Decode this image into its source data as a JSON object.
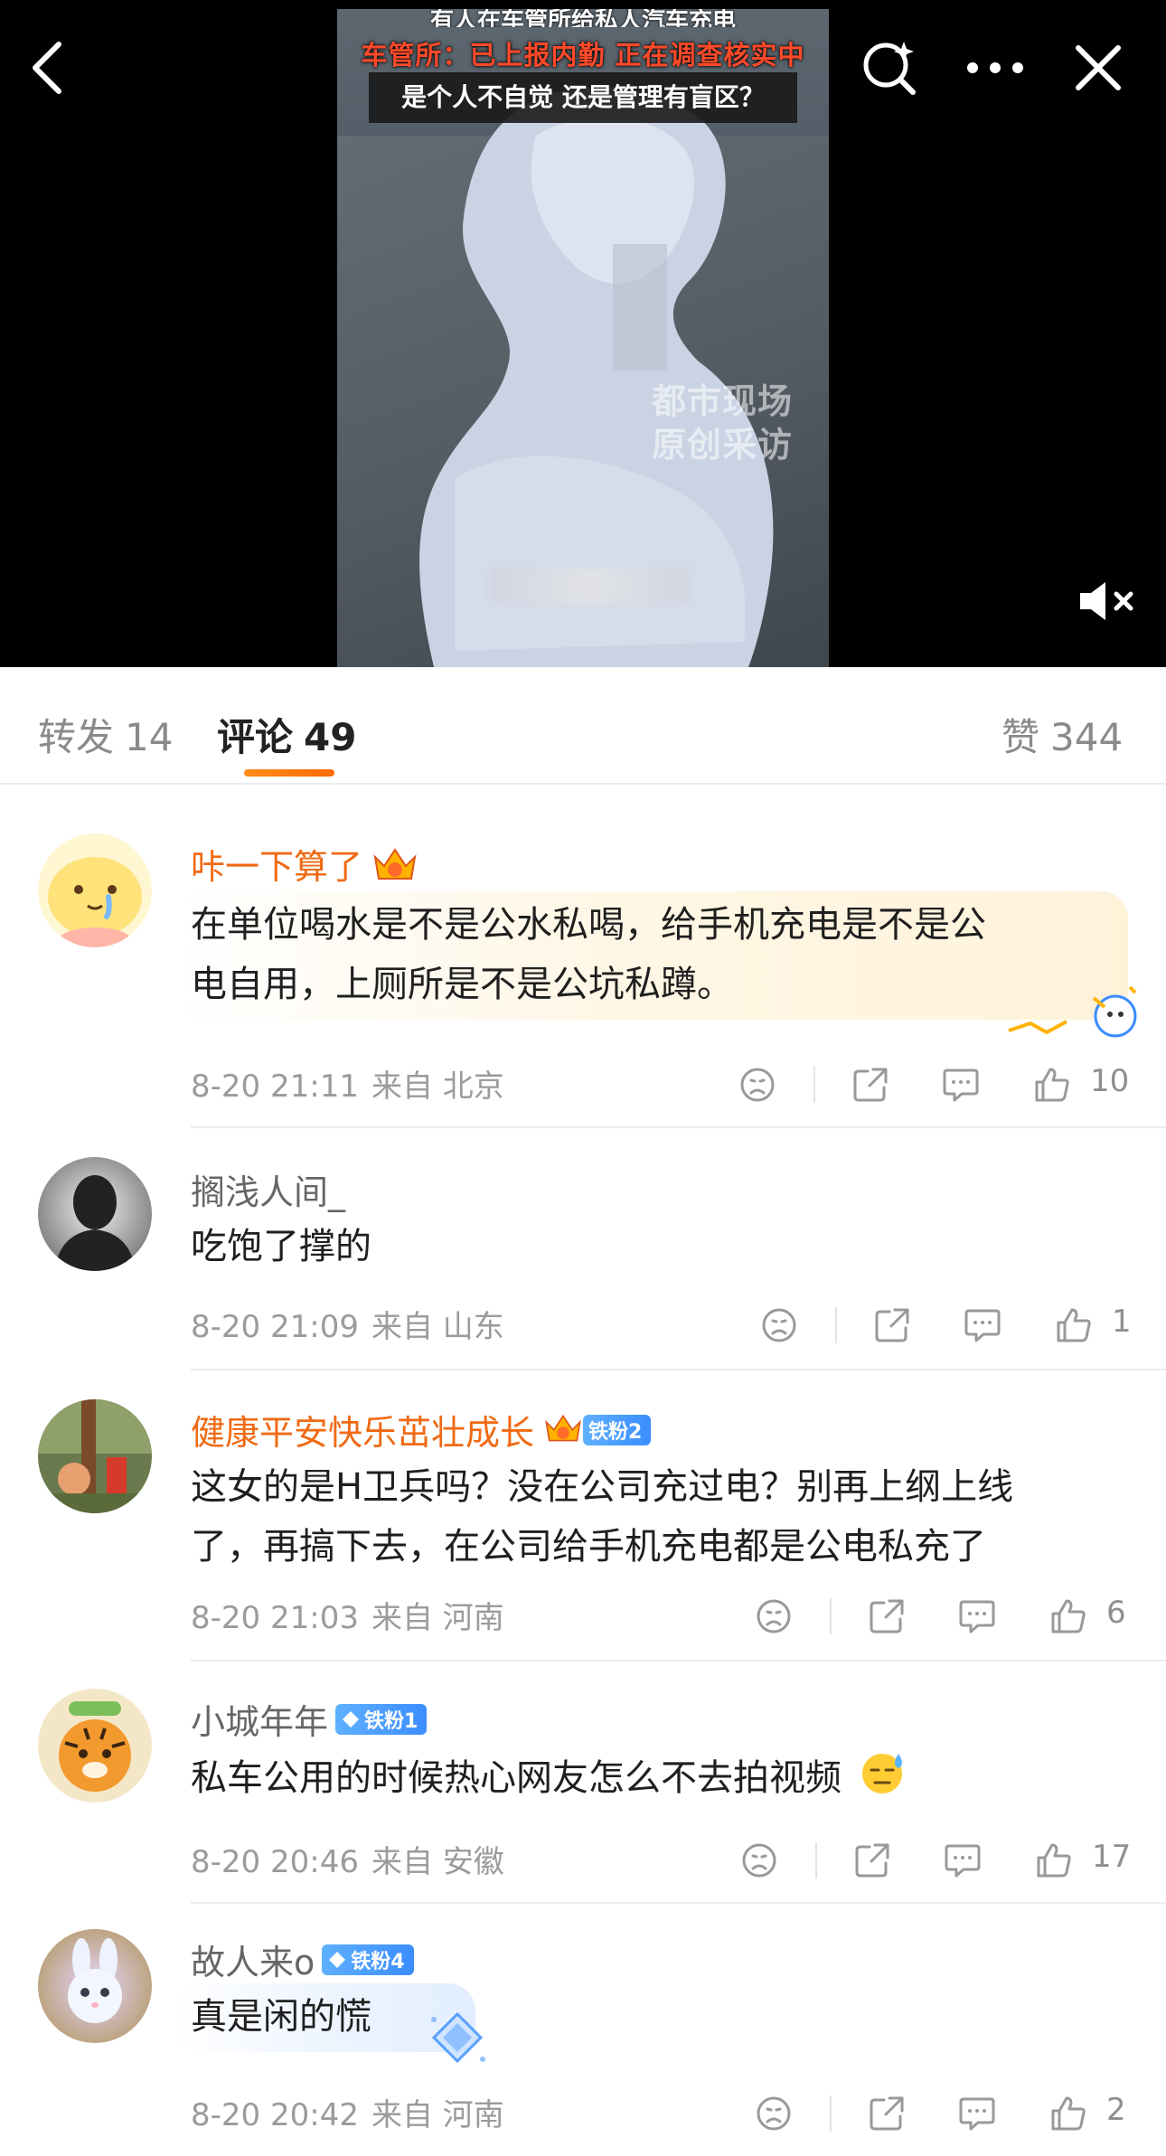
{
  "video": {
    "caption_top": "有人在车管所给私人汽车充电",
    "caption_mid": "车管所：已上报内勤 正在调查核实中",
    "caption_bottom": "是个人不自觉 还是管理有盲区？",
    "watermark_line1": "都市现场",
    "watermark_line2": "原创采访",
    "icons": [
      "back-icon",
      "ai-search-icon",
      "more-icon",
      "close-icon",
      "mute-icon"
    ]
  },
  "tabs": {
    "repost_label": "转发",
    "repost_count": "14",
    "comment_label": "评论",
    "comment_count": "49",
    "like_label": "赞",
    "like_count": "344",
    "accent": "#ff7a00"
  },
  "comments": [
    {
      "username": "咔一下算了",
      "username_color": "#f06a14",
      "text_line1": "在单位喝水是不是公水私喝，给手机充电是不是公",
      "text_line2": "电自用，上厕所是不是公坑私蹲。",
      "time": "8-20 21:11",
      "from": "来自 北京",
      "likes": "10"
    },
    {
      "username": "搁浅人间_",
      "text_line1": "吃饱了撑的",
      "time": "8-20 21:09",
      "from": "来自 山东",
      "likes": "1"
    },
    {
      "username": "健康平安快乐茁壮成长",
      "username_color": "#f06a14",
      "badge": "铁粉2",
      "text_line1": "这女的是H卫兵吗？没在公司充过电？别再上纲上线",
      "text_line2": "了，再搞下去，在公司给手机充电都是公电私充了",
      "time": "8-20 21:03",
      "from": "来自 河南",
      "likes": "6"
    },
    {
      "username": "小城年年",
      "badge": "铁粉1",
      "text_line1": "私车公用的时候热心网友怎么不去拍视频",
      "time": "8-20 20:46",
      "from": "来自 安徽",
      "likes": "17"
    },
    {
      "username": "故人来o",
      "badge": "铁粉4",
      "text_line1": "真是闲的慌",
      "time": "8-20 20:42",
      "from": "来自 河南",
      "likes": "2"
    }
  ]
}
